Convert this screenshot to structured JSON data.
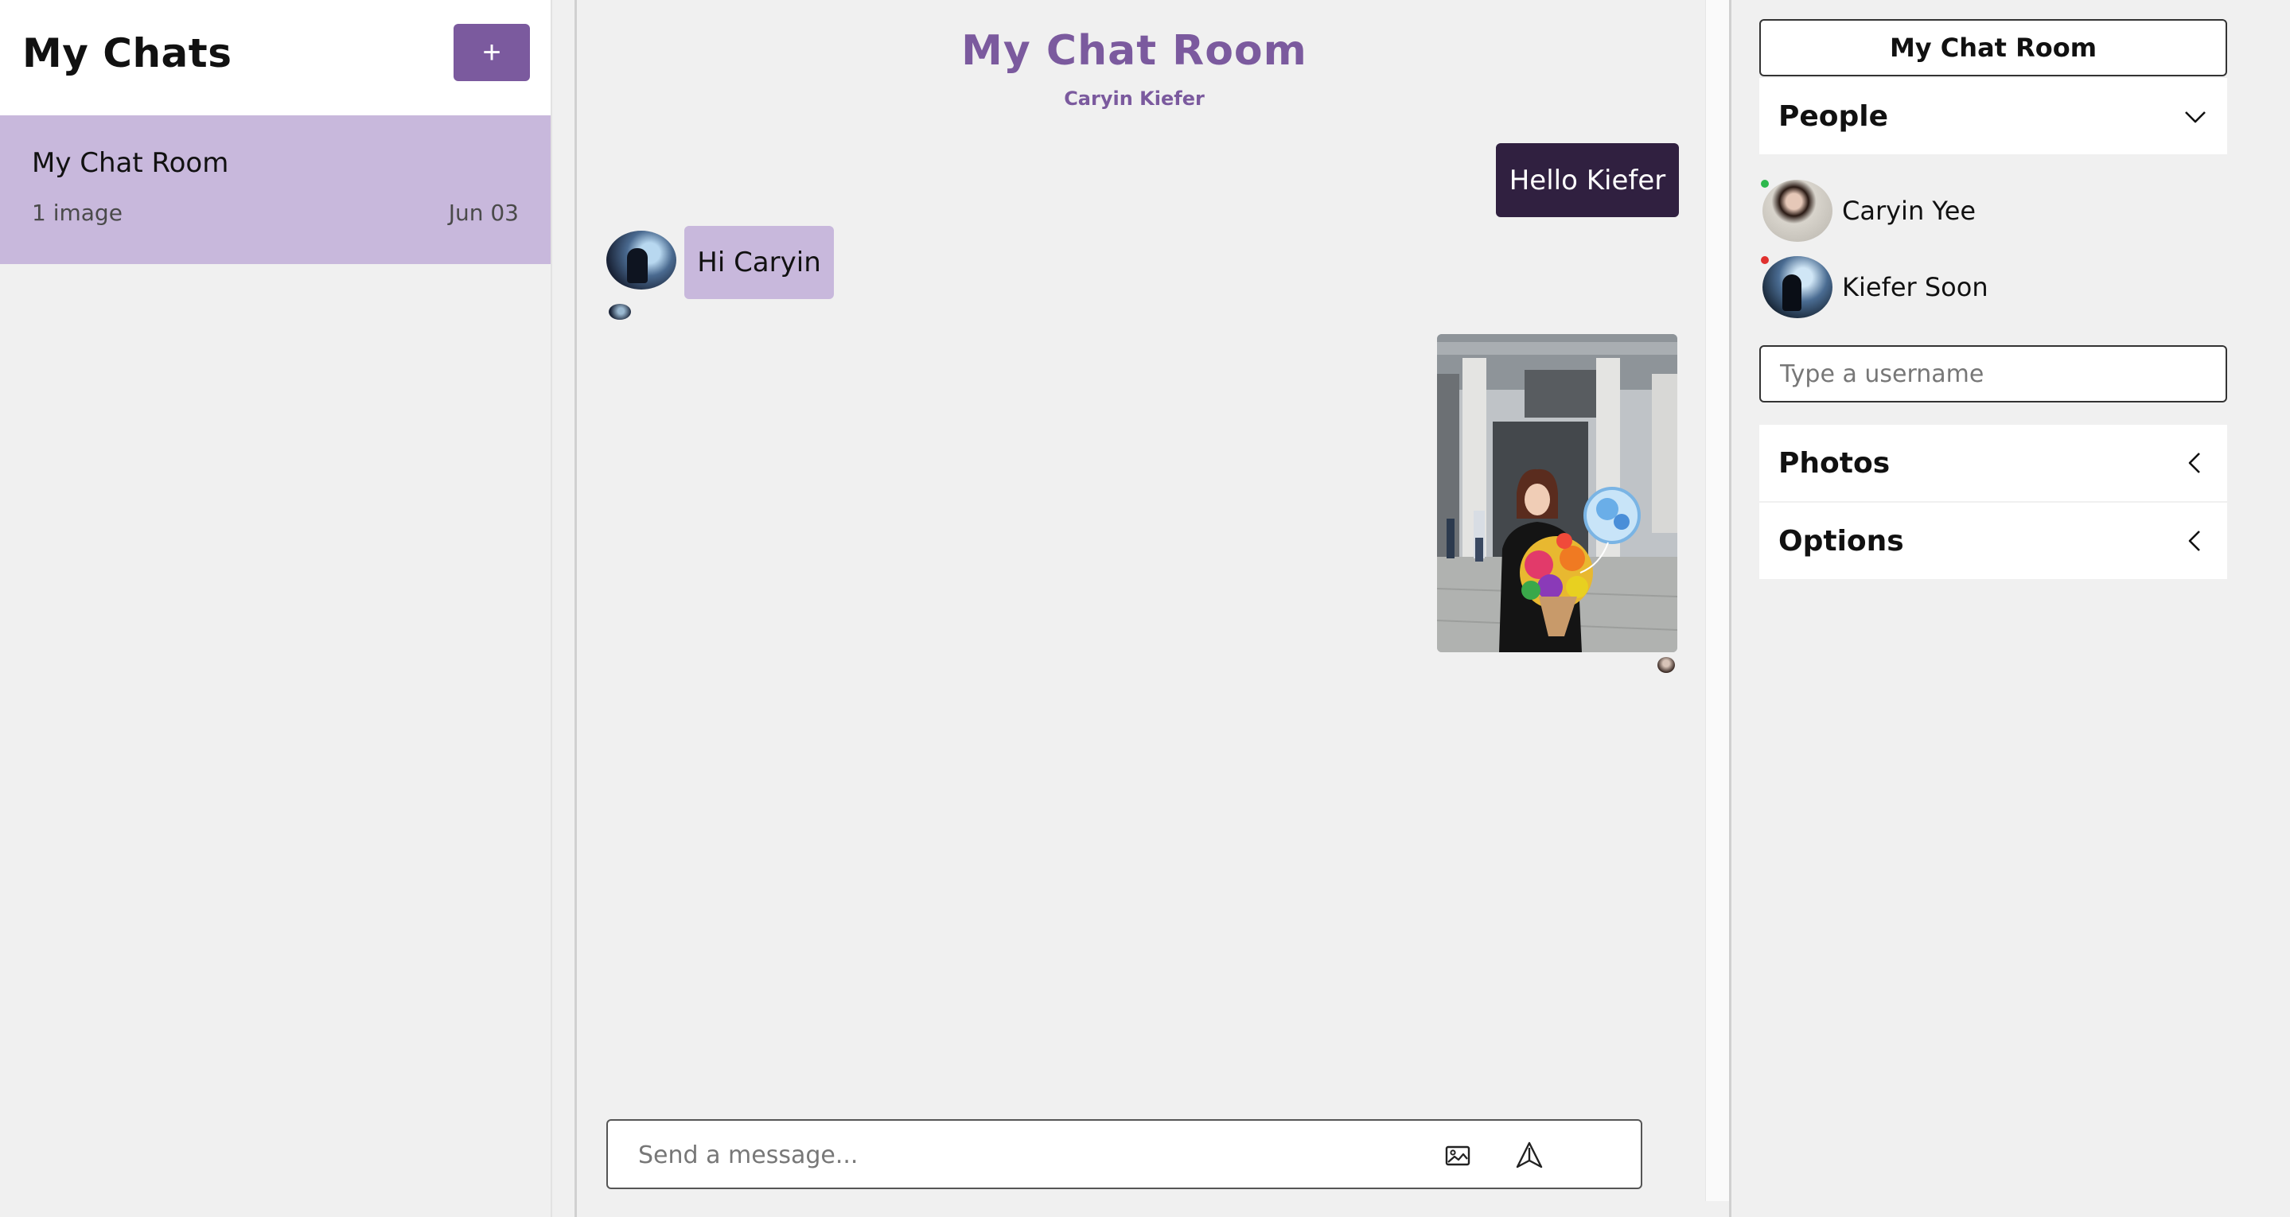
{
  "colors": {
    "accent": "#7b5a9e",
    "selected_chat_bg": "#c8b8dc",
    "outgoing_bubble": "#302040",
    "incoming_bubble": "#c8b8dc",
    "online": "#2db84d",
    "offline": "#e0302e"
  },
  "sidebar": {
    "title": "My Chats",
    "new_chat_label": "+",
    "chats": [
      {
        "title": "My Chat Room",
        "last_message": "1 image",
        "date": "Jun 03"
      }
    ]
  },
  "chat": {
    "title": "My Chat Room",
    "members": "Caryin Kiefer",
    "messages": [
      {
        "direction": "out",
        "text": "Hello Kiefer"
      },
      {
        "direction": "in",
        "text": "Hi Caryin"
      },
      {
        "direction": "out",
        "type": "image"
      }
    ],
    "composer": {
      "placeholder": "Send a message...",
      "image_icon": "image-icon",
      "send_icon": "send-icon"
    }
  },
  "settings": {
    "room_name": "My Chat Room",
    "people_label": "People",
    "people": [
      {
        "name": "Caryin Yee",
        "status": "online"
      },
      {
        "name": "Kiefer Soon",
        "status": "offline"
      }
    ],
    "add_user_placeholder": "Type a username",
    "photos_label": "Photos",
    "options_label": "Options"
  }
}
